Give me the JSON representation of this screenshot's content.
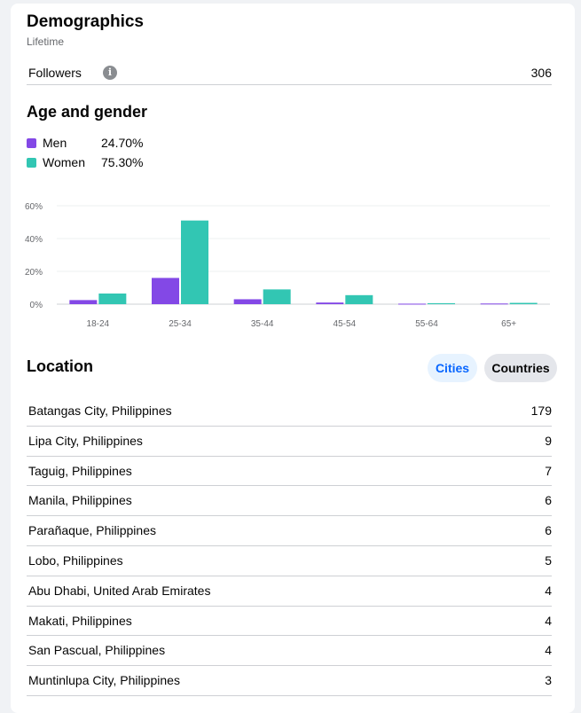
{
  "header": {
    "title": "Demographics",
    "subtitle": "Lifetime"
  },
  "followers": {
    "label": "Followers",
    "value": "306",
    "info_icon": "info-icon"
  },
  "age_gender": {
    "title": "Age and gender",
    "legend": [
      {
        "name": "Men",
        "pct": "24.70%",
        "color": "#8348e6"
      },
      {
        "name": "Women",
        "pct": "75.30%",
        "color": "#32c6b3"
      }
    ]
  },
  "chart_data": {
    "type": "bar",
    "categories": [
      "18-24",
      "25-34",
      "35-44",
      "45-54",
      "55-64",
      "65+"
    ],
    "series": [
      {
        "name": "Men",
        "color": "#8348e6",
        "values": [
          2.5,
          16,
          3,
          1,
          0.3,
          0.4
        ]
      },
      {
        "name": "Women",
        "color": "#32c6b3",
        "values": [
          6.5,
          51,
          9,
          5.5,
          0.6,
          0.8
        ]
      }
    ],
    "ylim": [
      0,
      60
    ],
    "yticks": [
      "60%",
      "40%",
      "20%",
      "0%"
    ],
    "grid": true
  },
  "location": {
    "title": "Location",
    "tabs": {
      "cities": "Cities",
      "countries": "Countries"
    },
    "rows": [
      {
        "name": "Batangas City, Philippines",
        "count": "179"
      },
      {
        "name": "Lipa City, Philippines",
        "count": "9"
      },
      {
        "name": "Taguig, Philippines",
        "count": "7"
      },
      {
        "name": "Manila, Philippines",
        "count": "6"
      },
      {
        "name": "Parañaque, Philippines",
        "count": "6"
      },
      {
        "name": "Lobo, Philippines",
        "count": "5"
      },
      {
        "name": "Abu Dhabi, United Arab Emirates",
        "count": "4"
      },
      {
        "name": "Makati, Philippines",
        "count": "4"
      },
      {
        "name": "San Pascual, Philippines",
        "count": "4"
      },
      {
        "name": "Muntinlupa City, Philippines",
        "count": "3"
      }
    ]
  }
}
